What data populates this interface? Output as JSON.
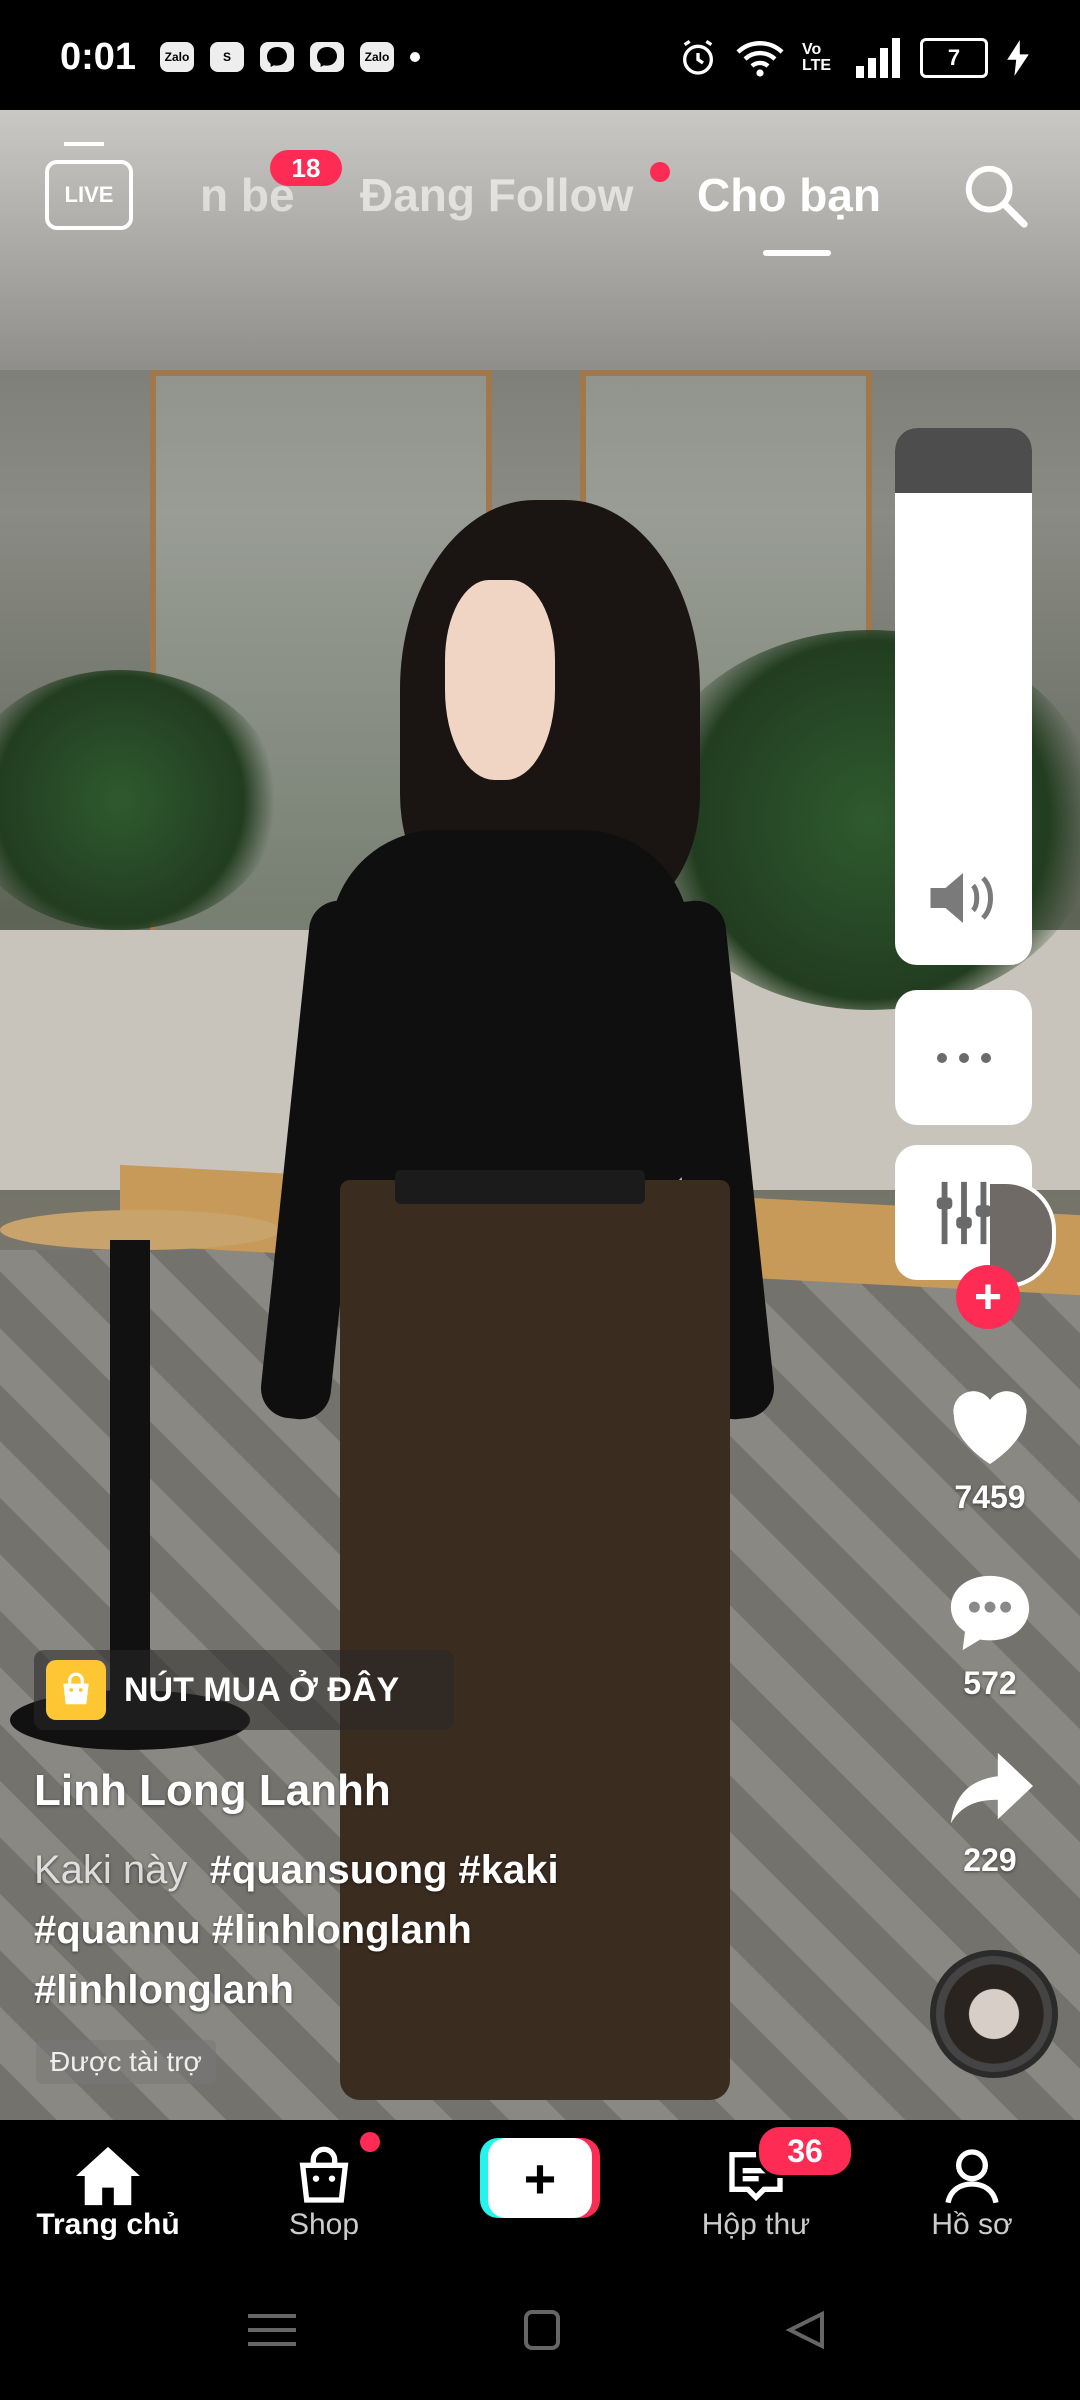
{
  "status_bar": {
    "time": "0:01",
    "app_icons": [
      "Zalo",
      "S",
      "messenger",
      "messenger",
      "Zalo"
    ],
    "battery": "7",
    "network": "Vo LTE"
  },
  "top_nav": {
    "live_label": "LIVE",
    "tabs": [
      {
        "label": "n bè",
        "badge": "18"
      },
      {
        "label": "Đang Follow",
        "dot": true
      },
      {
        "label": "Cho bạn",
        "active": true
      }
    ]
  },
  "right_rail": {
    "like_count": "7459",
    "comment_count": "572",
    "share_count": "229"
  },
  "post": {
    "shop_label": "NÚT MUA Ở ĐÂY",
    "author": "Linh Long Lanhh",
    "caption_plain": "Kaki này",
    "hashtags_line1": "#quansuong #kaki",
    "hashtags_line2": "#quannu #linhlonglanh",
    "hashtags_line3": "#linhlonglanh",
    "sponsored": "Được tài trợ"
  },
  "bottom_nav": {
    "items": [
      {
        "label": "Trang chủ",
        "active": true
      },
      {
        "label": "Shop"
      },
      {
        "label": ""
      },
      {
        "label": "Hộp thư",
        "badge": "36"
      },
      {
        "label": "Hồ sơ"
      }
    ]
  },
  "colors": {
    "accent": "#fe2c55",
    "cyan": "#25f4ee",
    "shop_yellow": "#ffc634"
  }
}
